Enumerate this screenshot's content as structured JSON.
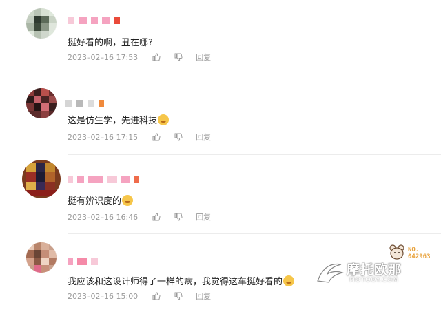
{
  "comments": [
    {
      "text": "挺好看的啊，丑在哪?",
      "emoji": null,
      "time": "2023–02–16 17:53",
      "reply_label": "回复"
    },
    {
      "text": "这是仿生学，先进科技",
      "emoji": "face-savoring-emoji",
      "time": "2023–02–16 17:15",
      "reply_label": "回复"
    },
    {
      "text": "挺有辨识度的",
      "emoji": "rolling-laughing-emoji",
      "time": "2023–02–16 16:46",
      "reply_label": "回复"
    },
    {
      "text": "我应该和这设计师得了一样的病，我觉得这车挺好看的",
      "emoji": "cat-emoji",
      "time": "2023–02–16 15:00",
      "reply_label": "回复"
    }
  ],
  "watermark": {
    "brand": "摩托欧那",
    "sub": "MOTOOY.COM",
    "badge_line1": "NO.",
    "badge_line2": "042963"
  },
  "colors": {
    "meta_gray": "#9a9a9a",
    "name_blur_pink": "#f5a3c0",
    "name_blur_red": "#ea4a3a",
    "badge_orange": "#e8a23c"
  },
  "icons": [
    "thumb-up-icon",
    "thumb-down-icon"
  ]
}
